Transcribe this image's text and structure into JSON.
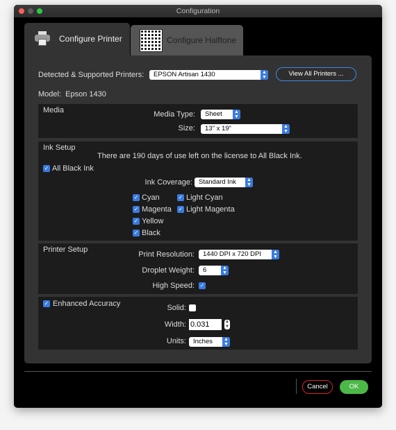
{
  "window": {
    "title": "Configuration"
  },
  "tabs": [
    {
      "label": "Configure Printer",
      "icon": "printer-icon"
    },
    {
      "label": "Configure Halftone",
      "icon": "halftone-icon"
    }
  ],
  "printer": {
    "label": "Detected & Supported Printers:",
    "value": "EPSON Artisan 1430",
    "view_all": "View All Printers ...",
    "model_label": "Model:",
    "model_value": "Epson 1430"
  },
  "media": {
    "title": "Media",
    "type_label": "Media Type:",
    "type_value": "Sheet",
    "size_label": "Size:",
    "size_value": "13\" x 19\""
  },
  "ink": {
    "title": "Ink Setup",
    "license": "There are 190 days of use left on the license to All Black Ink.",
    "all_black": "All Black Ink",
    "all_black_checked": true,
    "coverage_label": "Ink Coverage:",
    "coverage_value": "Standard Ink",
    "inks": [
      {
        "label": "Cyan",
        "checked": true
      },
      {
        "label": "Light Cyan",
        "checked": true
      },
      {
        "label": "Magenta",
        "checked": true
      },
      {
        "label": "Light Magenta",
        "checked": true
      },
      {
        "label": "Yellow",
        "checked": true
      },
      {
        "label": "Black",
        "checked": true
      }
    ]
  },
  "printer_setup": {
    "title": "Printer Setup",
    "resolution_label": "Print Resolution:",
    "resolution_value": "1440 DPI x 720 DPI",
    "droplet_label": "Droplet Weight:",
    "droplet_value": "6",
    "speed_label": "High Speed:",
    "speed_checked": true
  },
  "accuracy": {
    "title": "Enhanced Accuracy",
    "checked": true,
    "solid_label": "Solid:",
    "solid_checked": false,
    "width_label": "Width:",
    "width_value": "0.031",
    "units_label": "Units:",
    "units_value": "Inches"
  },
  "footer": {
    "cancel": "Cancel",
    "ok": "OK"
  },
  "colors": {
    "accent": "#3a7be0",
    "ok": "#4cb848",
    "cancel_border": "#e0202a"
  }
}
